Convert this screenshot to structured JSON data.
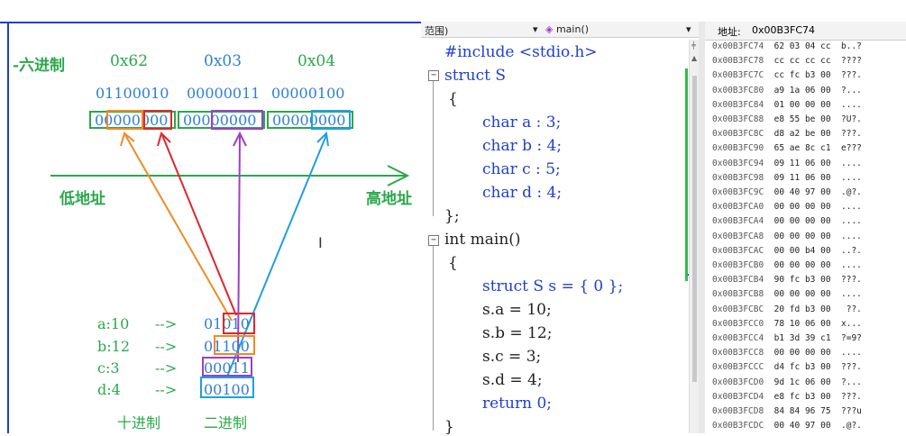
{
  "diagram": {
    "hex_title": "-六进制",
    "hex_values": [
      "0x62",
      "0x03",
      "0x04"
    ],
    "binary_groups": [
      "01100010",
      "00000011",
      "00000100"
    ],
    "memory_bytes": [
      "00000000",
      "00000000",
      "00000000"
    ],
    "low_addr_label": "低地址",
    "high_addr_label": "高地址",
    "mappings": [
      {
        "label": "a:10",
        "arrow": "-->",
        "binary": "01010"
      },
      {
        "label": "b:12",
        "arrow": "-->",
        "binary": "01100"
      },
      {
        "label": "c:3",
        "arrow": "-->",
        "binary": "00011"
      },
      {
        "label": "d:4",
        "arrow": "-->",
        "binary": "00100"
      }
    ],
    "decimal_label": "十进制",
    "binary_label": "二进制",
    "colors": {
      "blue": "#2f7ed8",
      "green": "#2aa84a",
      "orange": "#f08a24",
      "red": "#e0262b",
      "purple": "#9b3fc6",
      "cyan": "#1f9fdf"
    }
  },
  "editor": {
    "scope_dropdown": "范围)",
    "function_dropdown": "main()",
    "lines": [
      "#include <stdio.h>",
      "struct S",
      "{",
      "char a : 3;",
      "char b : 4;",
      "char c : 5;",
      "char d : 4;",
      "};",
      "int main()",
      "{",
      "struct S s = { 0 };",
      "s.a = 10;",
      "s.b = 12;",
      "s.c = 3;",
      "s.d = 4;",
      "return 0;",
      "}"
    ]
  },
  "memory": {
    "address_label": "地址:",
    "address_value": "0x00B3FC74",
    "rows": [
      {
        "addr": "0x00B3FC74",
        "bytes": "62 03 04 cc",
        "ascii": "b..?"
      },
      {
        "addr": "0x00B3FC78",
        "bytes": "cc cc cc cc",
        "ascii": "????"
      },
      {
        "addr": "0x00B3FC7C",
        "bytes": "cc fc b3 00",
        "ascii": "???."
      },
      {
        "addr": "0x00B3FC80",
        "bytes": "a9 1a 06 00",
        "ascii": "?..."
      },
      {
        "addr": "0x00B3FC84",
        "bytes": "01 00 00 00",
        "ascii": "...."
      },
      {
        "addr": "0x00B3FC88",
        "bytes": "e8 55 be 00",
        "ascii": "?U?."
      },
      {
        "addr": "0x00B3FC8C",
        "bytes": "d8 a2 be 00",
        "ascii": "???."
      },
      {
        "addr": "0x00B3FC90",
        "bytes": "65 ae 8c c1",
        "ascii": "e???"
      },
      {
        "addr": "0x00B3FC94",
        "bytes": "09 11 06 00",
        "ascii": "...."
      },
      {
        "addr": "0x00B3FC98",
        "bytes": "09 11 06 00",
        "ascii": "...."
      },
      {
        "addr": "0x00B3FC9C",
        "bytes": "00 40 97 00",
        "ascii": ".@?."
      },
      {
        "addr": "0x00B3FCA0",
        "bytes": "00 00 00 00",
        "ascii": "...."
      },
      {
        "addr": "0x00B3FCA4",
        "bytes": "00 00 00 00",
        "ascii": "...."
      },
      {
        "addr": "0x00B3FCA8",
        "bytes": "00 00 00 00",
        "ascii": "...."
      },
      {
        "addr": "0x00B3FCAC",
        "bytes": "00 00 b4 00",
        "ascii": "..?."
      },
      {
        "addr": "0x00B3FCB0",
        "bytes": "00 00 00 00",
        "ascii": "...."
      },
      {
        "addr": "0x00B3FCB4",
        "bytes": "90 fc b3 00",
        "ascii": "???."
      },
      {
        "addr": "0x00B3FCB8",
        "bytes": "00 00 00 00",
        "ascii": "...."
      },
      {
        "addr": "0x00B3FCBC",
        "bytes": "20 fd b3 00",
        "ascii": " ??."
      },
      {
        "addr": "0x00B3FCC0",
        "bytes": "78 10 06 00",
        "ascii": "x..."
      },
      {
        "addr": "0x00B3FCC4",
        "bytes": "b1 3d 39 c1",
        "ascii": "?=9?"
      },
      {
        "addr": "0x00B3FCC8",
        "bytes": "00 00 00 00",
        "ascii": "...."
      },
      {
        "addr": "0x00B3FCCC",
        "bytes": "d4 fc b3 00",
        "ascii": "???."
      },
      {
        "addr": "0x00B3FCD0",
        "bytes": "9d 1c 06 00",
        "ascii": "?..."
      },
      {
        "addr": "0x00B3FCD4",
        "bytes": "e8 fc b3 00",
        "ascii": "???."
      },
      {
        "addr": "0x00B3FCD8",
        "bytes": "84 84 96 75",
        "ascii": "???u"
      },
      {
        "addr": "0x00B3FCDC",
        "bytes": "00 40 97 00",
        "ascii": ".@?."
      }
    ]
  }
}
